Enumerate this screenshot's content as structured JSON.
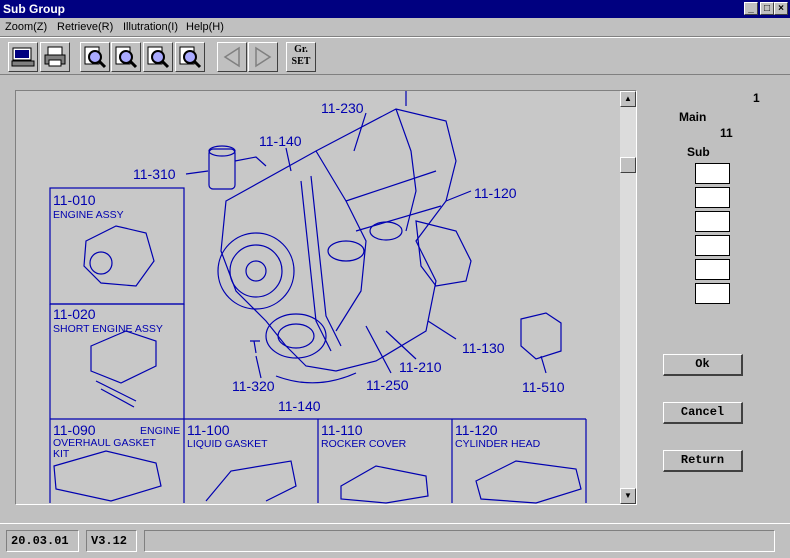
{
  "window": {
    "title": "Sub Group",
    "min": "_",
    "max": "□",
    "close": "×"
  },
  "menu": [
    {
      "label": "Zoom(Z)"
    },
    {
      "label": "Retrieve(R)"
    },
    {
      "label": "Illutration(I)"
    },
    {
      "label": "Help(H)"
    }
  ],
  "toolbar": {
    "gr_set_line1": "Gr.",
    "gr_set_line2": "SET"
  },
  "drawing": {
    "callouts": [
      "11-230",
      "11-140",
      "11-310",
      "11-120",
      "11-130",
      "11-210",
      "11-250",
      "11-320",
      "11-140",
      "11-510"
    ],
    "panels": [
      {
        "code": "11-010",
        "name": "ENGINE ASSY"
      },
      {
        "code": "11-020",
        "name": "SHORT ENGINE ASSY"
      },
      {
        "code": "11-090",
        "name_1": "ENGINE",
        "name_2": "OVERHAUL GASKET",
        "name_3": "KIT"
      },
      {
        "code": "11-100",
        "name": "LIQUID GASKET"
      },
      {
        "code": "11-110",
        "name": "ROCKER COVER"
      },
      {
        "code": "11-120",
        "name": "CYLINDER HEAD"
      }
    ]
  },
  "right_panel": {
    "page": "1",
    "main_label": "Main",
    "main_value": "11",
    "sub_label": "Sub",
    "sub_fields": [
      "",
      "",
      "",
      "",
      "",
      ""
    ]
  },
  "buttons": {
    "ok": "Ok",
    "cancel": "Cancel",
    "return": "Return"
  },
  "status": {
    "date": "20.03.01",
    "version": "V3.12",
    "message": ""
  },
  "colors": {
    "titlebar": "#000080",
    "drawing_ink": "#0000b0",
    "face": "#c0c0c0"
  }
}
